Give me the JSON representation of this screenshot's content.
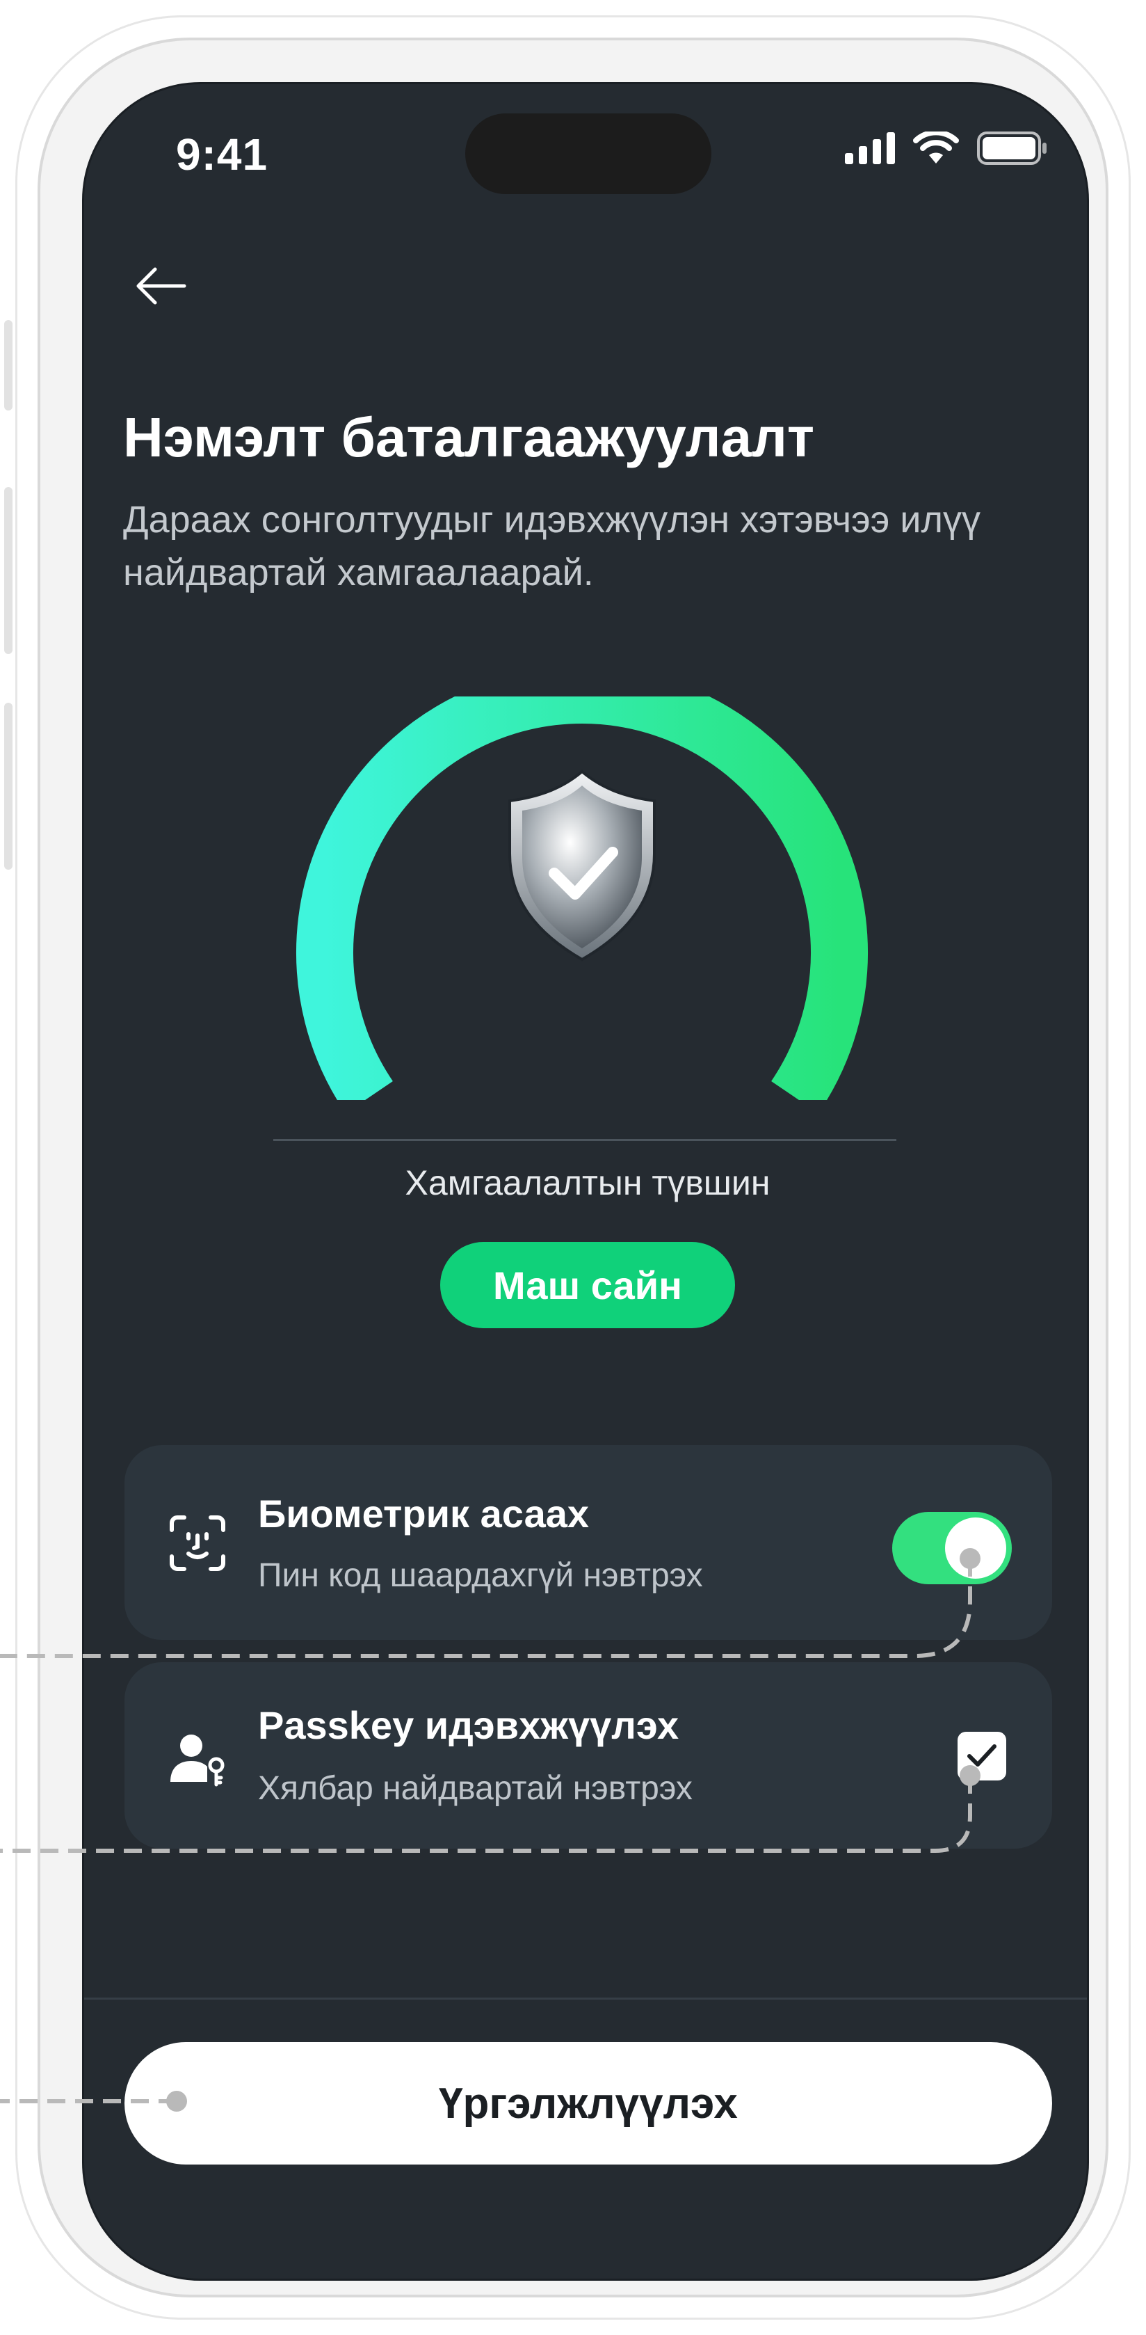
{
  "status_bar": {
    "time": "9:41"
  },
  "header": {
    "title": "Нэмэлт баталгаажуулалт",
    "subtitle": "Дараах сонголтуудыг идэвхжүүлэн хэтэвчээ илүү найдвартай хамгаалаарай."
  },
  "security_level": {
    "label": "Хамгаалалтын түвшин",
    "badge": "Маш сайн",
    "fraction": 1.0
  },
  "options": [
    {
      "title": "Биометрик асаах",
      "subtitle": "Пин код шаардахгүй нэвтрэх",
      "icon": "face-id-icon",
      "control": "toggle",
      "enabled": true
    },
    {
      "title": "Passkey идэвхжүүлэх",
      "subtitle": "Хялбар найдвартай нэвтрэх",
      "icon": "user-key-icon",
      "control": "checkbox",
      "checked": true
    }
  ],
  "footer": {
    "continue_label": "Үргэлжлүүлэх"
  },
  "colors": {
    "background": "#252b31",
    "card": "#2c353d",
    "accent_green": "#10d17a",
    "gauge_start": "#3ff5dc",
    "gauge_end": "#27e37a",
    "toggle_on": "#33e07f"
  }
}
